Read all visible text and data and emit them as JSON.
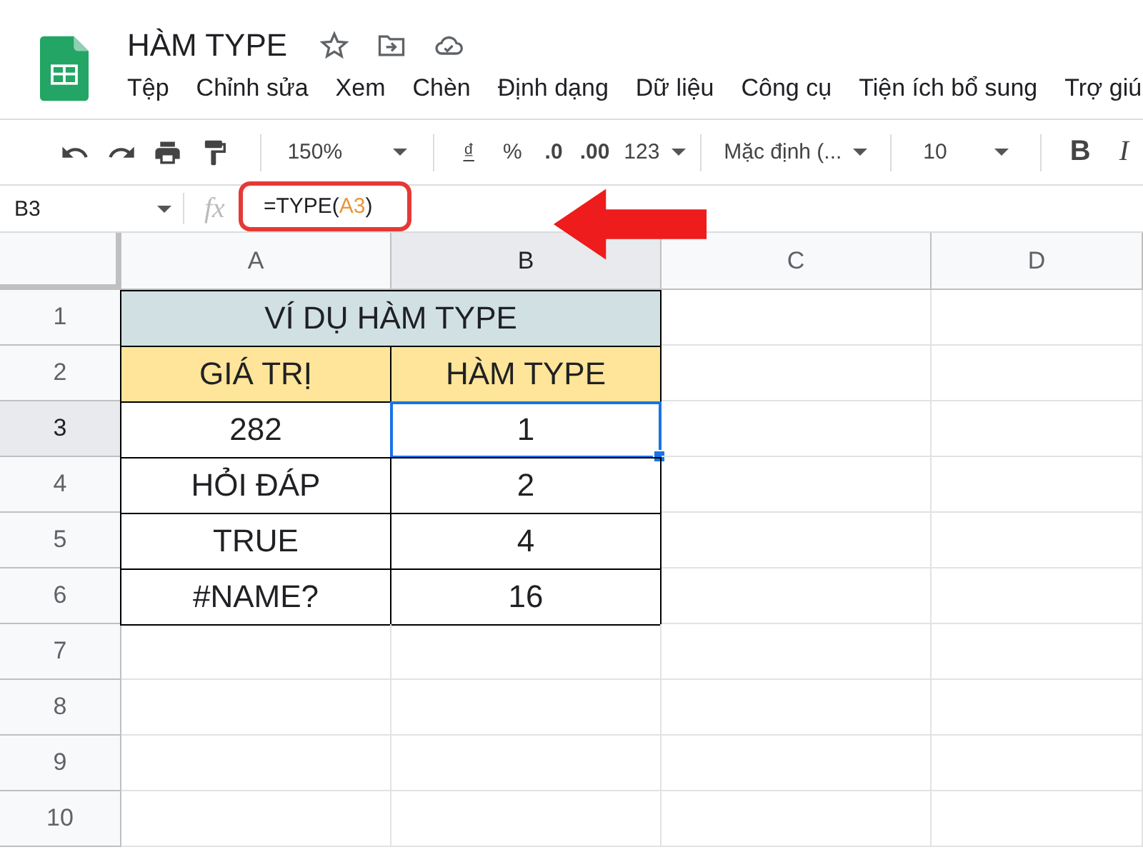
{
  "document": {
    "title": "HÀM TYPE"
  },
  "menu": [
    "Tệp",
    "Chỉnh sửa",
    "Xem",
    "Chèn",
    "Định dạng",
    "Dữ liệu",
    "Công cụ",
    "Tiện ích bổ sung",
    "Trợ giú"
  ],
  "toolbar": {
    "zoom": "150%",
    "currency": "₫",
    "percent": "%",
    "decrease_decimal": ".0",
    "increase_decimal": ".00",
    "number_format": "123",
    "font": "Mặc định (...",
    "font_size": "10",
    "bold": "B",
    "italic": "I"
  },
  "formula_bar": {
    "name_box": "B3",
    "fx": "fx",
    "formula": [
      {
        "text": "=TYPE(",
        "kind": "plain"
      },
      {
        "text": "A3",
        "kind": "ref"
      },
      {
        "text": ")",
        "kind": "plain"
      }
    ]
  },
  "sheet": {
    "columns": [
      {
        "label": "A",
        "selected": false
      },
      {
        "label": "B",
        "selected": true
      },
      {
        "label": "C",
        "selected": false
      },
      {
        "label": "D",
        "selected": false
      }
    ],
    "rows": [
      {
        "label": "1",
        "selected": false,
        "cells": [
          {
            "text": "VÍ DỤ HÀM TYPE",
            "kind": "title",
            "selected": false
          }
        ]
      },
      {
        "label": "2",
        "selected": false,
        "cells": [
          {
            "text": "GIÁ TRỊ",
            "kind": "header",
            "selected": false
          },
          {
            "text": "HÀM TYPE",
            "kind": "header",
            "selected": false
          }
        ]
      },
      {
        "label": "3",
        "selected": true,
        "cells": [
          {
            "text": "282",
            "kind": "value",
            "selected": false
          },
          {
            "text": "1",
            "kind": "value",
            "selected": true
          }
        ]
      },
      {
        "label": "4",
        "selected": false,
        "cells": [
          {
            "text": "HỎI ĐÁP",
            "kind": "value",
            "selected": false
          },
          {
            "text": "2",
            "kind": "value",
            "selected": false
          }
        ]
      },
      {
        "label": "5",
        "selected": false,
        "cells": [
          {
            "text": "TRUE",
            "kind": "value",
            "selected": false
          },
          {
            "text": "4",
            "kind": "value",
            "selected": false
          }
        ]
      },
      {
        "label": "6",
        "selected": false,
        "cells": [
          {
            "text": "#NAME?",
            "kind": "value",
            "selected": false
          },
          {
            "text": "16",
            "kind": "value",
            "selected": false
          }
        ]
      },
      {
        "label": "7",
        "selected": false
      },
      {
        "label": "8",
        "selected": false
      },
      {
        "label": "9",
        "selected": false
      },
      {
        "label": "10",
        "selected": false
      }
    ]
  }
}
